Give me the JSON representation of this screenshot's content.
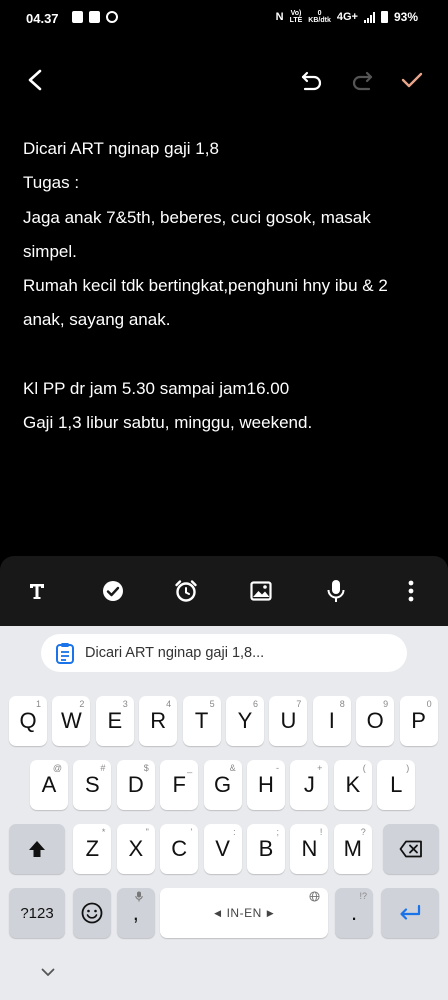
{
  "status_bar": {
    "time": "04.37",
    "volte_top": "Vo)",
    "volte_bottom": "LTE",
    "speed_top": "0",
    "speed_bottom": "KB/dtk",
    "network": "4G+",
    "battery": "93%"
  },
  "note": {
    "lines": [
      "Dicari ART nginap gaji 1,8",
      "Tugas :",
      "Jaga anak 7&5th, beberes, cuci gosok, masak",
      "simpel.",
      "Rumah kecil tdk bertingkat,penghuni hny ibu & 2",
      "anak, sayang anak.",
      "",
      "Kl PP dr jam 5.30 sampai jam16.00",
      "Gaji 1,3 libur sabtu, minggu, weekend."
    ]
  },
  "clipboard": {
    "preview": "Dicari ART nginap gaji 1,8..."
  },
  "keyboard": {
    "row1": [
      {
        "label": "Q",
        "hint": "1"
      },
      {
        "label": "W",
        "hint": "2"
      },
      {
        "label": "E",
        "hint": "3"
      },
      {
        "label": "R",
        "hint": "4"
      },
      {
        "label": "T",
        "hint": "5"
      },
      {
        "label": "Y",
        "hint": "6"
      },
      {
        "label": "U",
        "hint": "7"
      },
      {
        "label": "I",
        "hint": "8"
      },
      {
        "label": "O",
        "hint": "9"
      },
      {
        "label": "P",
        "hint": "0"
      }
    ],
    "row2": [
      {
        "label": "A",
        "hint": "@"
      },
      {
        "label": "S",
        "hint": "#"
      },
      {
        "label": "D",
        "hint": "$"
      },
      {
        "label": "F",
        "hint": "_"
      },
      {
        "label": "G",
        "hint": "&"
      },
      {
        "label": "H",
        "hint": "-"
      },
      {
        "label": "J",
        "hint": "+"
      },
      {
        "label": "K",
        "hint": "("
      },
      {
        "label": "L",
        "hint": ")"
      }
    ],
    "row3": [
      {
        "label": "Z",
        "hint": "*"
      },
      {
        "label": "X",
        "hint": "\""
      },
      {
        "label": "C",
        "hint": "'"
      },
      {
        "label": "V",
        "hint": ":"
      },
      {
        "label": "B",
        "hint": ";"
      },
      {
        "label": "N",
        "hint": "!"
      },
      {
        "label": "M",
        "hint": "?"
      }
    ],
    "symbols_label": "?123",
    "comma_label": ",",
    "space_label": "IN-EN",
    "period_label": ".",
    "period_hint": "!?"
  },
  "colors": {
    "background": "#000000",
    "note_toolbar": "#181818",
    "keyboard_bg": "#e9eaee",
    "accent_done": "#e8a58b",
    "enter_key": "#1a73e8"
  }
}
